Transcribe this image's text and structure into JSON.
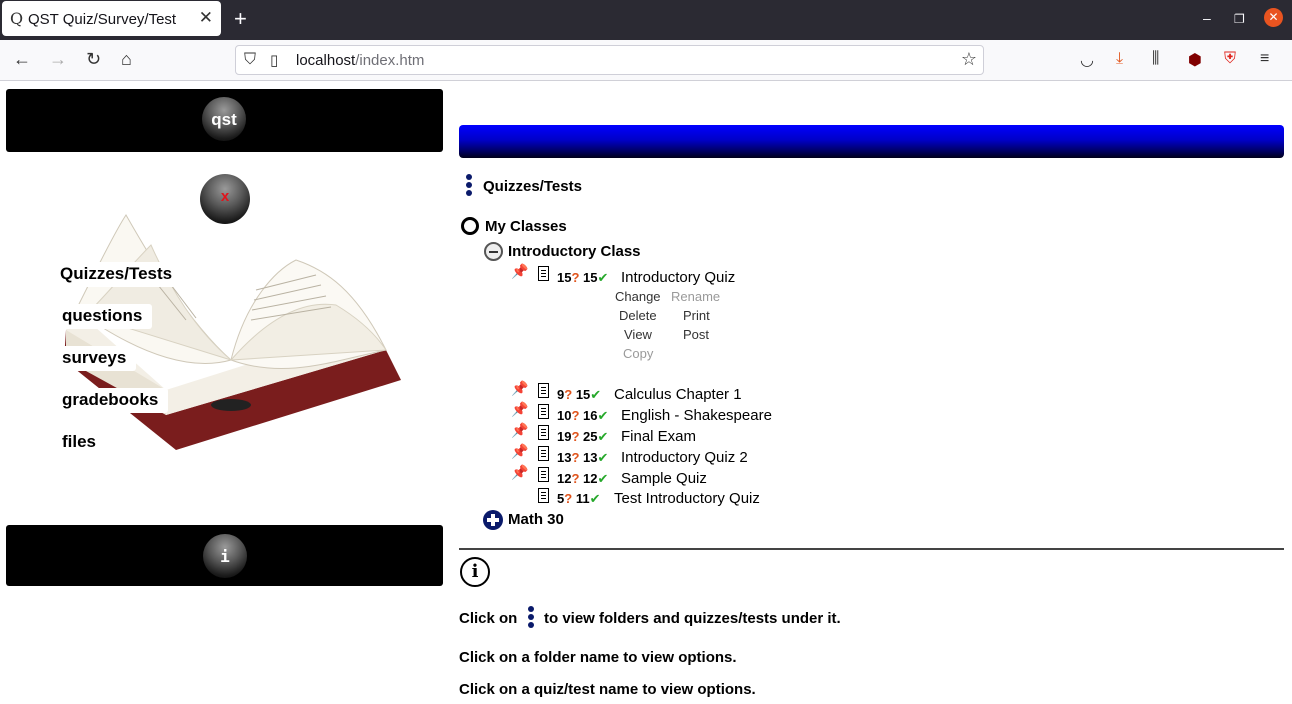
{
  "browser": {
    "tab_title": "QST Quiz/Survey/Test",
    "tab_favicon": "Q",
    "url_host": "localhost",
    "url_path": "/index.htm"
  },
  "left": {
    "logo_label": "qst",
    "close_orb_label": "x",
    "info_orb_label": "i",
    "menu": {
      "quizzes": "Quizzes/Tests",
      "questions": "questions",
      "surveys": "surveys",
      "gradebooks": "gradebooks",
      "files": "files"
    }
  },
  "main": {
    "section_title": "Quizzes/Tests",
    "root_folder": "My Classes",
    "folder_intro": "Introductory Class",
    "folder_math": "Math 30",
    "quizzes": [
      {
        "q": "15",
        "c": "15",
        "name": "Introductory Quiz",
        "pinned": true
      },
      {
        "q": "9",
        "c": "15",
        "name": "Calculus Chapter 1",
        "pinned": true
      },
      {
        "q": "10",
        "c": "16",
        "name": "English - Shakespeare",
        "pinned": true
      },
      {
        "q": "19",
        "c": "25",
        "name": "Final Exam",
        "pinned": true
      },
      {
        "q": "13",
        "c": "13",
        "name": "Introductory Quiz 2",
        "pinned": true
      },
      {
        "q": "12",
        "c": "12",
        "name": "Sample Quiz",
        "pinned": true
      },
      {
        "q": "5",
        "c": "11",
        "name": "Test Introductory Quiz",
        "pinned": false
      }
    ],
    "options": {
      "change": "Change",
      "rename": "Rename",
      "delete": "Delete",
      "print": "Print",
      "view": "View",
      "post": "Post",
      "copy": "Copy"
    },
    "q_mark": "?",
    "check_mark": "✔",
    "help": {
      "line1_before": "Click on",
      "line1_after": "to view folders and quizzes/tests under it.",
      "line2": "Click on a folder name to view options.",
      "line3": "Click on a quiz/test name to view options."
    }
  }
}
